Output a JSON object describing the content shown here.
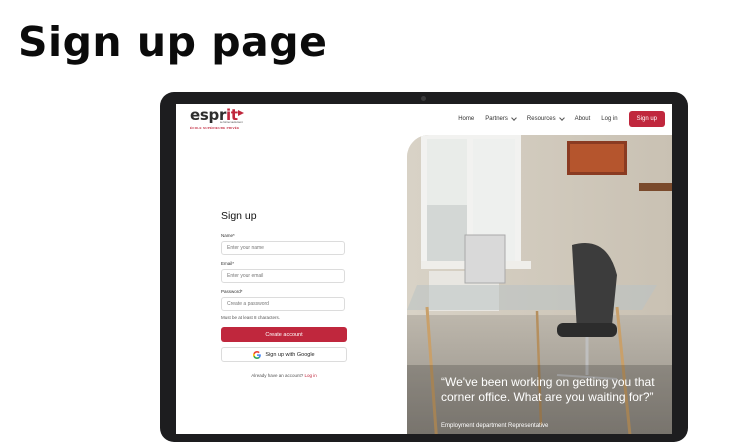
{
  "page": {
    "heading": "Sign up page"
  },
  "nav": {
    "logo_text_main": "espr",
    "logo_text_accent": "it",
    "logo_tagline": "se former autrement",
    "logo_subtitle": "ÉCOLE SUPÉRIEURE PRIVÉE",
    "links": [
      "Home",
      "Partners",
      "Resources",
      "About",
      "Log in"
    ],
    "cta": "Sign up"
  },
  "form": {
    "title": "Sign up",
    "name_label": "Name*",
    "name_placeholder": "Enter your name",
    "email_label": "Email*",
    "email_placeholder": "Enter your email",
    "password_label": "Password*",
    "password_placeholder": "Create a password",
    "password_hint": "Must be at least 8 characters.",
    "create_button": "Create account",
    "google_button": "Sign up with Google",
    "already_text": "Already have an account?",
    "login_link": "Log in"
  },
  "hero": {
    "quote": "“We've been working on getting you that corner office. What are you waiting for?”",
    "author": "Employment department Representative"
  },
  "colors": {
    "accent": "#c0273d",
    "laptop_frame": "#1d1d1f"
  },
  "icons": [
    "chevron-down-icon",
    "google-icon",
    "logo-flag-icon"
  ]
}
